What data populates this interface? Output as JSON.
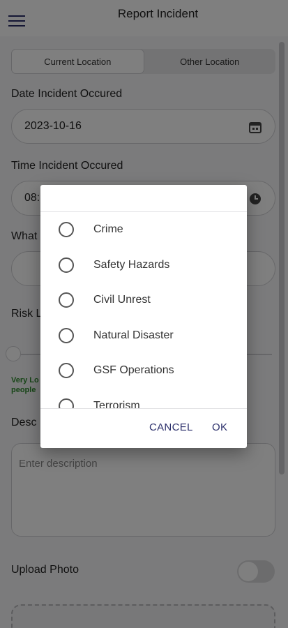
{
  "header": {
    "title": "Report Incident",
    "menu_icon": "menu-icon"
  },
  "location_toggle": {
    "options": [
      "Current Location",
      "Other Location"
    ],
    "selected": "Current Location"
  },
  "date_field": {
    "label": "Date Incident Occured",
    "value": "2023-10-16",
    "icon": "calendar-icon"
  },
  "time_field": {
    "label": "Time Incident Occured",
    "value_partial": "08:",
    "icon": "clock-icon"
  },
  "partial_labels": {
    "what": "What",
    "risk": "Risk L",
    "desc": "Desc"
  },
  "risk": {
    "level": 0,
    "text_line1": "Very Lo",
    "text_line2": "people"
  },
  "description": {
    "placeholder": "Enter description"
  },
  "upload": {
    "label": "Upload Photo",
    "enabled": false
  },
  "dialog": {
    "options": [
      "Crime",
      "Safety Hazards",
      "Civil Unrest",
      "Natural Disaster",
      "GSF Operations",
      "Terrorism"
    ],
    "cancel_label": "CANCEL",
    "ok_label": "OK"
  },
  "colors": {
    "accent": "#2b2f6b",
    "risk_green": "#2e8b2e",
    "overlay": "#000000"
  }
}
